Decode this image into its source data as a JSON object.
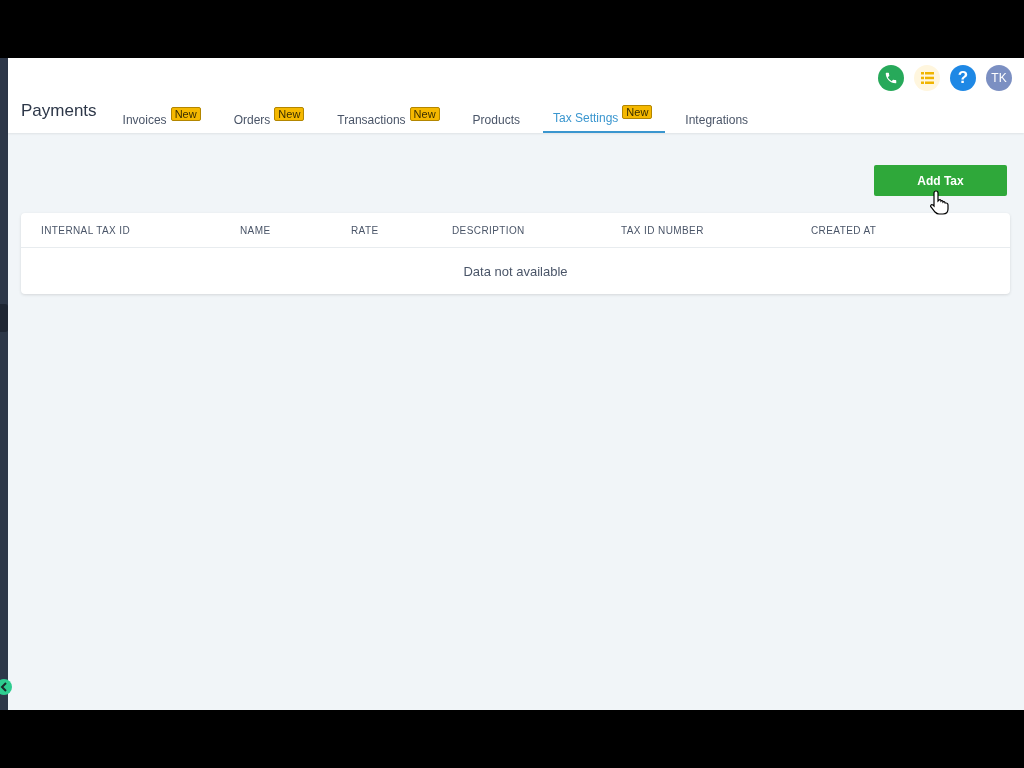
{
  "header": {
    "title": "Payments",
    "tabs": [
      {
        "label": "Invoices",
        "badge": "New",
        "selected": false
      },
      {
        "label": "Orders",
        "badge": "New",
        "selected": false
      },
      {
        "label": "Transactions",
        "badge": "New",
        "selected": false
      },
      {
        "label": "Products",
        "selected": false
      },
      {
        "label": "Tax Settings",
        "badge": "New",
        "selected": true
      },
      {
        "label": "Integrations",
        "selected": false
      }
    ],
    "actions": [
      {
        "kind": "phone"
      },
      {
        "kind": "list"
      },
      {
        "kind": "help",
        "label": "?"
      },
      {
        "kind": "avatar",
        "label": "TK"
      }
    ]
  },
  "add_button": "Add Tax",
  "table": {
    "columns": [
      "INTERNAL TAX ID",
      "NAME",
      "RATE",
      "DESCRIPTION",
      "TAX ID NUMBER",
      "CREATED AT"
    ],
    "empty_message": "Data not available"
  }
}
